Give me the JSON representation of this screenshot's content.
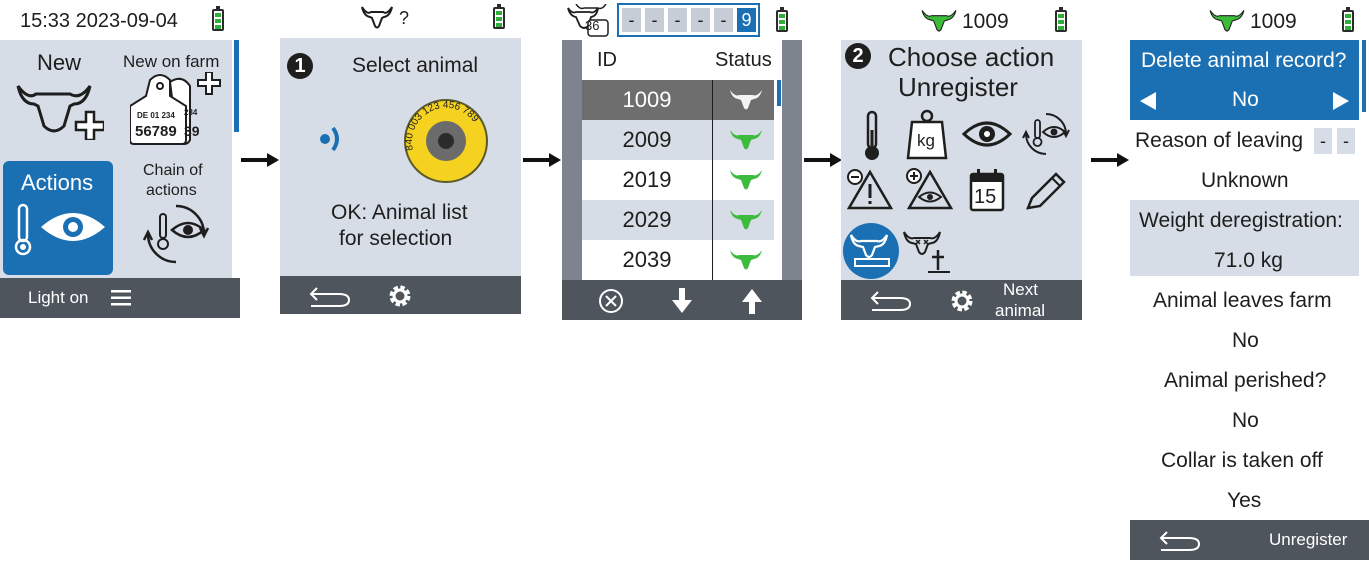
{
  "screen1": {
    "time_date": "15:33 2023-09-04",
    "new_label": "New",
    "new_on_farm_label": "New on farm",
    "tag_line1": "DE 01 234",
    "tag_number": "56789",
    "tag_partial": "39",
    "tag_partial_top": "234",
    "actions_label": "Actions",
    "chain_label_1": "Chain of",
    "chain_label_2": "actions",
    "footer_label": "Light on"
  },
  "screen2": {
    "header_status": "?",
    "step_number": "1",
    "title": "Select animal",
    "tag_ring_text": "840 003 123 456 789",
    "hint_1": "OK: Animal list",
    "hint_2": "for selection"
  },
  "screen3": {
    "herd_count": "36",
    "id_digits": [
      "-",
      "-",
      "-",
      "-",
      "-",
      "9"
    ],
    "col_id": "ID",
    "col_status": "Status",
    "rows": [
      {
        "id": "1009",
        "selected": true
      },
      {
        "id": "2009",
        "selected": false
      },
      {
        "id": "2019",
        "selected": false
      },
      {
        "id": "2029",
        "selected": false
      },
      {
        "id": "2039",
        "selected": false
      }
    ]
  },
  "screen4": {
    "animal_id": "1009",
    "step_number": "2",
    "title_1": "Choose action",
    "title_2": "Unregister",
    "scale_label": "kg",
    "calendar_day": "15",
    "footer_next_1": "Next",
    "footer_next_2": "animal"
  },
  "screen5": {
    "animal_id": "1009",
    "delete_question": "Delete animal record?",
    "delete_value": "No",
    "reason_label": "Reason of leaving",
    "reason_boxes": [
      "-",
      "-"
    ],
    "reason_value": "Unknown",
    "weight_label": "Weight deregistration:",
    "weight_value": "71.0 kg",
    "leaves_label": "Animal leaves farm",
    "leaves_value": "No",
    "perished_label": "Animal perished?",
    "perished_value": "No",
    "collar_label": "Collar is taken off",
    "collar_value": "Yes",
    "footer_label": "Unregister"
  },
  "colors": {
    "panel": "#d7dde6",
    "footer": "#4f555d",
    "accent_blue": "#1b70b4",
    "cow_green": "#3dbb3d",
    "battery_green": "#2fae3a",
    "tag_yellow": "#f4d21f"
  }
}
